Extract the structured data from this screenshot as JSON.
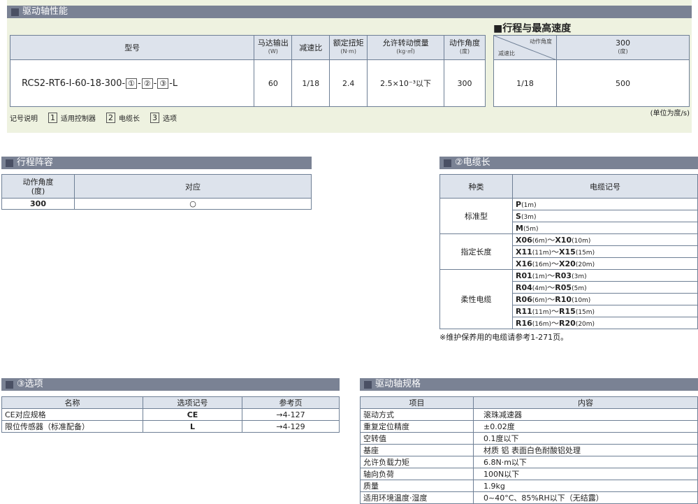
{
  "perf": {
    "title": "驱动轴性能",
    "headers": {
      "model": "型号",
      "motor": "马达输出",
      "motor_unit": "(W)",
      "ratio": "减速比",
      "torque": "额定扭矩",
      "torque_unit": "(N·m)",
      "inertia": "允许转动惯量",
      "inertia_unit": "(kg·㎡)",
      "angle": "动作角度",
      "angle_unit": "(度)"
    },
    "row": {
      "model_prefix": "RCS2-RT6-I-60-18-300-",
      "b1": "①",
      "b2": "②",
      "b3": "③",
      "dash": "-",
      "model_suffix": "-L",
      "motor": "60",
      "ratio": "1/18",
      "torque": "2.4",
      "inertia": "2.5×10⁻³以下",
      "angle": "300"
    },
    "legend": {
      "label": "记号说明",
      "k1": "1",
      "t1": "适用控制器",
      "k2": "2",
      "t2": "电缆长",
      "k3": "3",
      "t3": "选项"
    }
  },
  "speed": {
    "title": "■行程与最高速度",
    "diag_top": "动作角度",
    "diag_bottom": "减速比",
    "col": "300",
    "col_unit": "(度)",
    "ratio": "1/18",
    "value": "500",
    "unit_note": "(单位为度/s)"
  },
  "stroke": {
    "title": "行程阵容",
    "h1": "动作角度",
    "h1b": "(度)",
    "h2": "对应",
    "v1": "300",
    "v2": "○"
  },
  "cable": {
    "title": "②电缆长",
    "h1": "种类",
    "h2": "电缆记号",
    "groups": [
      {
        "name": "标准型",
        "rows": [
          {
            "a": "P",
            "al": "(1m)",
            "sep": "",
            "b": "",
            "bl": ""
          },
          {
            "a": "S",
            "al": "(3m)",
            "sep": "",
            "b": "",
            "bl": ""
          },
          {
            "a": "M",
            "al": "(5m)",
            "sep": "",
            "b": "",
            "bl": ""
          }
        ]
      },
      {
        "name": "指定长度",
        "rows": [
          {
            "a": "X06",
            "al": "(6m)",
            "sep": "～",
            "b": "X10",
            "bl": "(10m)"
          },
          {
            "a": "X11",
            "al": "(11m)",
            "sep": "～",
            "b": "X15",
            "bl": "(15m)"
          },
          {
            "a": "X16",
            "al": "(16m)",
            "sep": "～",
            "b": "X20",
            "bl": "(20m)"
          }
        ]
      },
      {
        "name": "柔性电缆",
        "rows": [
          {
            "a": "R01",
            "al": "(1m)",
            "sep": "～",
            "b": "R03",
            "bl": "(3m)"
          },
          {
            "a": "R04",
            "al": "(4m)",
            "sep": "～",
            "b": "R05",
            "bl": "(5m)"
          },
          {
            "a": "R06",
            "al": "(6m)",
            "sep": "～",
            "b": "R10",
            "bl": "(10m)"
          },
          {
            "a": "R11",
            "al": "(11m)",
            "sep": "～",
            "b": "R15",
            "bl": "(15m)"
          },
          {
            "a": "R16",
            "al": "(16m)",
            "sep": "～",
            "b": "R20",
            "bl": "(20m)"
          }
        ]
      }
    ],
    "note": "※维护保养用的电缆请参考1-271页。"
  },
  "options": {
    "title": "③选项",
    "h1": "名称",
    "h2": "选项记号",
    "h3": "参考页",
    "rows": [
      {
        "name": "CE对应规格",
        "code": "CE",
        "page": "→4-127"
      },
      {
        "name": "限位传感器（标准配备）",
        "code": "L",
        "page": "→4-129"
      }
    ]
  },
  "spec": {
    "title": "驱动轴规格",
    "h1": "项目",
    "h2": "内容",
    "rows": [
      {
        "k": "驱动方式",
        "v": "滚珠减速器"
      },
      {
        "k": "重复定位精度",
        "v": "±0.02度"
      },
      {
        "k": "空转值",
        "v": "0.1度以下"
      },
      {
        "k": "基座",
        "v": "材质 铝 表面白色耐酸铝处理"
      },
      {
        "k": "允许负载力矩",
        "v": "6.8N·m以下"
      },
      {
        "k": "轴向负荷",
        "v": "100N以下"
      },
      {
        "k": "质量",
        "v": "1.9kg"
      },
      {
        "k": "适用环境温度·湿度",
        "v": "0~40°C、85%RH以下（无结露）"
      }
    ]
  }
}
